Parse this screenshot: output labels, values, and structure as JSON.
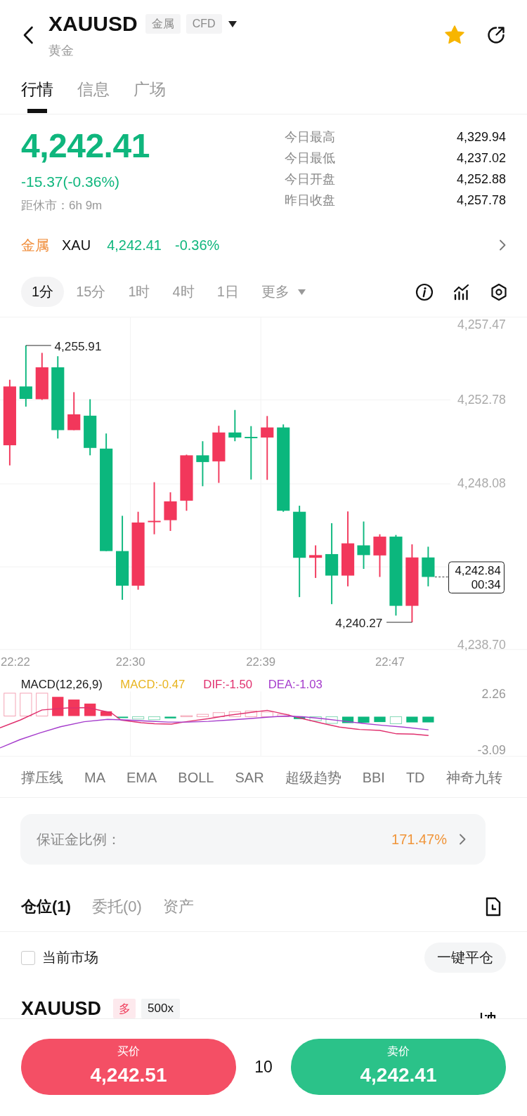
{
  "header": {
    "title": "XAUUSD",
    "tags": [
      "金属",
      "CFD"
    ],
    "subtitle": "黄金",
    "favorite": true
  },
  "tabs": [
    {
      "label": "行情",
      "selected": true
    },
    {
      "label": "信息",
      "selected": false
    },
    {
      "label": "广场",
      "selected": false
    }
  ],
  "quote": {
    "price": "4,242.41",
    "change": "-15.37(-0.36%)",
    "close_countdown": "距休市：6h 9m",
    "stats": [
      {
        "label": "今日最高",
        "value": "4,329.94"
      },
      {
        "label": "今日最低",
        "value": "4,237.02"
      },
      {
        "label": "今日开盘",
        "value": "4,252.88"
      },
      {
        "label": "昨日收盘",
        "value": "4,257.78"
      }
    ]
  },
  "related": {
    "category": "金属",
    "symbol": "XAU",
    "price": "4,242.41",
    "change": "-0.36%"
  },
  "timeframes": [
    {
      "label": "1分",
      "kind": "interval",
      "selected": true
    },
    {
      "label": "15分",
      "kind": "interval",
      "selected": false
    },
    {
      "label": "1时",
      "kind": "interval",
      "selected": false
    },
    {
      "label": "4时",
      "kind": "interval",
      "selected": false
    },
    {
      "label": "1日",
      "kind": "interval",
      "selected": false
    },
    {
      "label": "更多",
      "kind": "menu",
      "selected": false
    }
  ],
  "chart": {
    "price_labels": [
      "4,257.47",
      "4,252.78",
      "4,248.08",
      "4,238.70"
    ],
    "time_labels": [
      "22:22",
      "22:30",
      "22:39",
      "22:47"
    ],
    "high_marker": "4,255.91",
    "low_marker": "4,240.27",
    "last_price": "4,242.84",
    "countdown": "00:34"
  },
  "macd": {
    "legend": [
      {
        "label": "MACD(12,26,9)",
        "color": "#1a1a1a"
      },
      {
        "label": "MACD:-0.47",
        "color": "#e8b41e"
      },
      {
        "label": "DIF:-1.50",
        "color": "#e0306e"
      },
      {
        "label": "DEA:-1.03",
        "color": "#a53ccc"
      }
    ],
    "axis_labels": [
      "2.26",
      "-3.09"
    ]
  },
  "indicators": [
    "撑压线",
    "MA",
    "EMA",
    "BOLL",
    "SAR",
    "超级趋势",
    "BBI",
    "TD",
    "神奇九转"
  ],
  "margin": {
    "label": "保证金比例：",
    "value": "171.47%"
  },
  "position_tabs": [
    {
      "label": "仓位(1)",
      "selected": true
    },
    {
      "label": "委托(0)",
      "selected": false
    },
    {
      "label": "资产",
      "selected": false
    }
  ],
  "filter": {
    "label": "当前市场",
    "checked": false
  },
  "close_all": "一键平仓",
  "position": {
    "symbol": "XAUUSD",
    "side": "多",
    "leverage": "500x"
  },
  "order_bar": {
    "buy": {
      "label": "买价",
      "price": "4,242.51"
    },
    "quantity": "10",
    "sell": {
      "label": "卖价",
      "price": "4,242.41"
    }
  }
}
